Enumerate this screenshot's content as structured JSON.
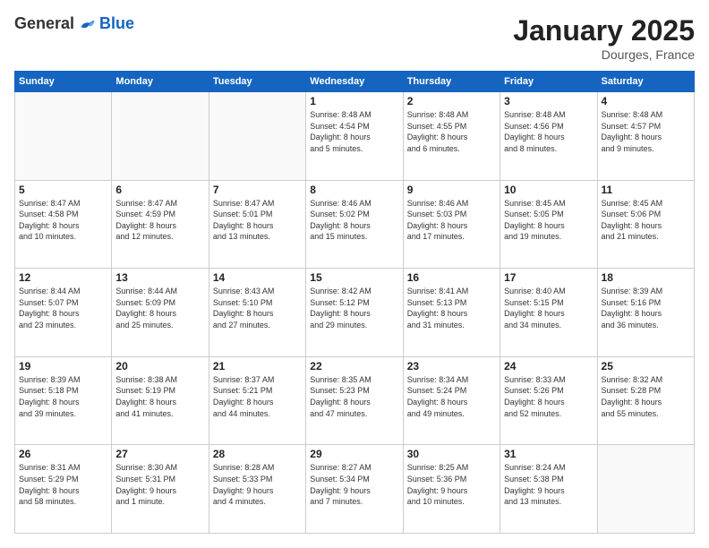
{
  "logo": {
    "general": "General",
    "blue": "Blue"
  },
  "title": "January 2025",
  "location": "Dourges, France",
  "days_of_week": [
    "Sunday",
    "Monday",
    "Tuesday",
    "Wednesday",
    "Thursday",
    "Friday",
    "Saturday"
  ],
  "weeks": [
    [
      {
        "day": "",
        "info": ""
      },
      {
        "day": "",
        "info": ""
      },
      {
        "day": "",
        "info": ""
      },
      {
        "day": "1",
        "info": "Sunrise: 8:48 AM\nSunset: 4:54 PM\nDaylight: 8 hours\nand 5 minutes."
      },
      {
        "day": "2",
        "info": "Sunrise: 8:48 AM\nSunset: 4:55 PM\nDaylight: 8 hours\nand 6 minutes."
      },
      {
        "day": "3",
        "info": "Sunrise: 8:48 AM\nSunset: 4:56 PM\nDaylight: 8 hours\nand 8 minutes."
      },
      {
        "day": "4",
        "info": "Sunrise: 8:48 AM\nSunset: 4:57 PM\nDaylight: 8 hours\nand 9 minutes."
      }
    ],
    [
      {
        "day": "5",
        "info": "Sunrise: 8:47 AM\nSunset: 4:58 PM\nDaylight: 8 hours\nand 10 minutes."
      },
      {
        "day": "6",
        "info": "Sunrise: 8:47 AM\nSunset: 4:59 PM\nDaylight: 8 hours\nand 12 minutes."
      },
      {
        "day": "7",
        "info": "Sunrise: 8:47 AM\nSunset: 5:01 PM\nDaylight: 8 hours\nand 13 minutes."
      },
      {
        "day": "8",
        "info": "Sunrise: 8:46 AM\nSunset: 5:02 PM\nDaylight: 8 hours\nand 15 minutes."
      },
      {
        "day": "9",
        "info": "Sunrise: 8:46 AM\nSunset: 5:03 PM\nDaylight: 8 hours\nand 17 minutes."
      },
      {
        "day": "10",
        "info": "Sunrise: 8:45 AM\nSunset: 5:05 PM\nDaylight: 8 hours\nand 19 minutes."
      },
      {
        "day": "11",
        "info": "Sunrise: 8:45 AM\nSunset: 5:06 PM\nDaylight: 8 hours\nand 21 minutes."
      }
    ],
    [
      {
        "day": "12",
        "info": "Sunrise: 8:44 AM\nSunset: 5:07 PM\nDaylight: 8 hours\nand 23 minutes."
      },
      {
        "day": "13",
        "info": "Sunrise: 8:44 AM\nSunset: 5:09 PM\nDaylight: 8 hours\nand 25 minutes."
      },
      {
        "day": "14",
        "info": "Sunrise: 8:43 AM\nSunset: 5:10 PM\nDaylight: 8 hours\nand 27 minutes."
      },
      {
        "day": "15",
        "info": "Sunrise: 8:42 AM\nSunset: 5:12 PM\nDaylight: 8 hours\nand 29 minutes."
      },
      {
        "day": "16",
        "info": "Sunrise: 8:41 AM\nSunset: 5:13 PM\nDaylight: 8 hours\nand 31 minutes."
      },
      {
        "day": "17",
        "info": "Sunrise: 8:40 AM\nSunset: 5:15 PM\nDaylight: 8 hours\nand 34 minutes."
      },
      {
        "day": "18",
        "info": "Sunrise: 8:39 AM\nSunset: 5:16 PM\nDaylight: 8 hours\nand 36 minutes."
      }
    ],
    [
      {
        "day": "19",
        "info": "Sunrise: 8:39 AM\nSunset: 5:18 PM\nDaylight: 8 hours\nand 39 minutes."
      },
      {
        "day": "20",
        "info": "Sunrise: 8:38 AM\nSunset: 5:19 PM\nDaylight: 8 hours\nand 41 minutes."
      },
      {
        "day": "21",
        "info": "Sunrise: 8:37 AM\nSunset: 5:21 PM\nDaylight: 8 hours\nand 44 minutes."
      },
      {
        "day": "22",
        "info": "Sunrise: 8:35 AM\nSunset: 5:23 PM\nDaylight: 8 hours\nand 47 minutes."
      },
      {
        "day": "23",
        "info": "Sunrise: 8:34 AM\nSunset: 5:24 PM\nDaylight: 8 hours\nand 49 minutes."
      },
      {
        "day": "24",
        "info": "Sunrise: 8:33 AM\nSunset: 5:26 PM\nDaylight: 8 hours\nand 52 minutes."
      },
      {
        "day": "25",
        "info": "Sunrise: 8:32 AM\nSunset: 5:28 PM\nDaylight: 8 hours\nand 55 minutes."
      }
    ],
    [
      {
        "day": "26",
        "info": "Sunrise: 8:31 AM\nSunset: 5:29 PM\nDaylight: 8 hours\nand 58 minutes."
      },
      {
        "day": "27",
        "info": "Sunrise: 8:30 AM\nSunset: 5:31 PM\nDaylight: 9 hours\nand 1 minute."
      },
      {
        "day": "28",
        "info": "Sunrise: 8:28 AM\nSunset: 5:33 PM\nDaylight: 9 hours\nand 4 minutes."
      },
      {
        "day": "29",
        "info": "Sunrise: 8:27 AM\nSunset: 5:34 PM\nDaylight: 9 hours\nand 7 minutes."
      },
      {
        "day": "30",
        "info": "Sunrise: 8:25 AM\nSunset: 5:36 PM\nDaylight: 9 hours\nand 10 minutes."
      },
      {
        "day": "31",
        "info": "Sunrise: 8:24 AM\nSunset: 5:38 PM\nDaylight: 9 hours\nand 13 minutes."
      },
      {
        "day": "",
        "info": ""
      }
    ]
  ]
}
